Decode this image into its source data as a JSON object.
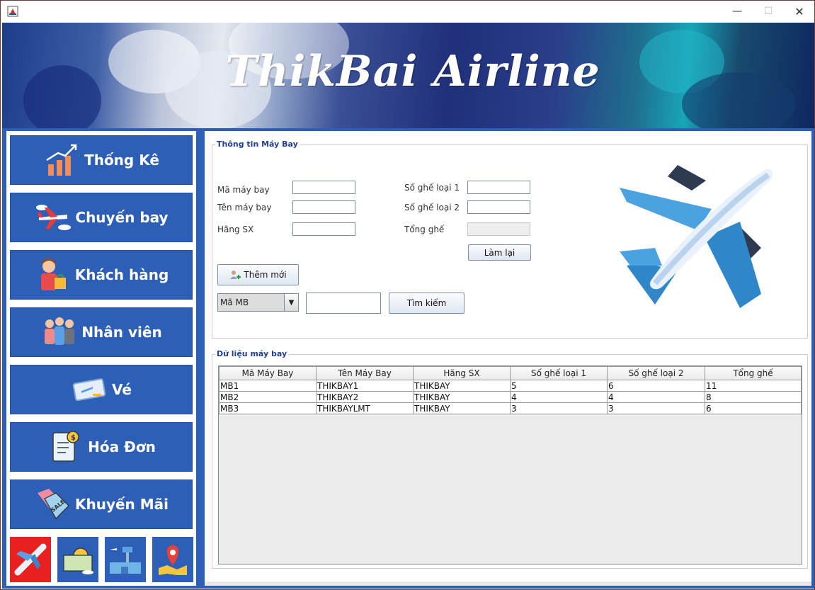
{
  "app": {
    "title": "ThikBai Airline"
  },
  "window_controls": {
    "minimize": "—",
    "maximize": "☐",
    "close": "✕"
  },
  "sidebar": {
    "items": [
      {
        "label": "Thống Kê",
        "icon": "bar-chart-icon"
      },
      {
        "label": "Chuyến bay",
        "icon": "airplane-clouds-icon"
      },
      {
        "label": "Khách hàng",
        "icon": "customer-shopping-icon"
      },
      {
        "label": "Nhân viên",
        "icon": "staff-group-icon"
      },
      {
        "label": "Vé",
        "icon": "ticket-icon"
      },
      {
        "label": "Hóa Đơn",
        "icon": "invoice-icon"
      },
      {
        "label": "Khuyến Mãi",
        "icon": "sale-tag-icon"
      }
    ],
    "tiles": [
      "airplane-tile-icon",
      "world-travel-tile-icon",
      "airport-tile-icon",
      "map-pin-tile-icon"
    ],
    "active_tile_color": "#e8201e",
    "button_color": "#2c5fb5"
  },
  "info_panel": {
    "title": "Thông tin Máy Bay",
    "labels": {
      "ma_may_bay": "Mã máy bay",
      "ten_may_bay": "Tên máy bay",
      "hang_sx": "Hãng SX",
      "so_ghe_loai_1": "Số ghế loại 1",
      "so_ghe_loai_2": "Số ghế loại 2",
      "tong_ghe": "Tổng ghế"
    },
    "values": {
      "ma_may_bay": "",
      "ten_may_bay": "",
      "hang_sx": "",
      "so_ghe_loai_1": "",
      "so_ghe_loai_2": "",
      "tong_ghe": ""
    },
    "buttons": {
      "lam_lai": "Làm lại",
      "them_moi": "Thêm mới",
      "tim_kiem": "Tìm kiếm"
    },
    "search": {
      "field_selected": "Mã MB",
      "query": ""
    }
  },
  "data_panel": {
    "title": "Dữ liệu máy bay",
    "columns": [
      "Mã Máy Bay",
      "Tên Máy Bay",
      "Hãng SX",
      "Số ghế loại 1",
      "Số ghế loại 2",
      "Tổng ghế"
    ],
    "rows": [
      [
        "MB1",
        "THIKBAY1",
        "THIKBAY",
        "5",
        "6",
        "11"
      ],
      [
        "MB2",
        "THIKBAY2",
        "THIKBAY",
        "4",
        "4",
        "8"
      ],
      [
        "MB3",
        "THIKBAYLMT",
        "THIKBAY",
        "3",
        "3",
        "6"
      ]
    ]
  }
}
